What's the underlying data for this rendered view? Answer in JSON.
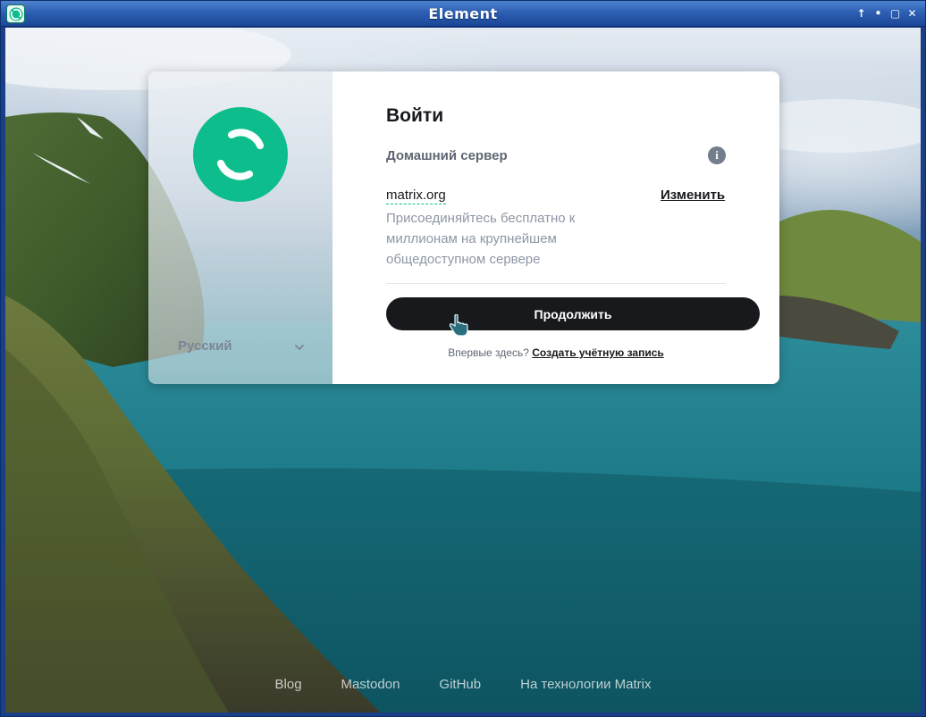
{
  "window": {
    "title": "Element",
    "icons": [
      "element-app-icon",
      "arrow-up-icon",
      "minimize-icon",
      "maximize-icon",
      "close-icon"
    ],
    "controls": {
      "up": "↑",
      "minimize": "•",
      "maximize": "▢",
      "close": "✕"
    }
  },
  "auth": {
    "language": "Русский",
    "heading": "Войти",
    "homeserver_label": "Домашний сервер",
    "server_name": "matrix.org",
    "change_label": "Изменить",
    "server_description": "Присоединяйтесь бесплатно к миллионам на крупнейшем общедоступном сервере",
    "continue_label": "Продолжить",
    "new_here": "Впервые здесь?",
    "create_account": "Создать учётную запись"
  },
  "footer": {
    "links": [
      "Blog",
      "Mastodon",
      "GitHub",
      "На технологии Matrix"
    ]
  },
  "colors": {
    "accent": "#0dbd8b",
    "button_bg": "#17191c",
    "titlebar": "#2d5fb3"
  }
}
